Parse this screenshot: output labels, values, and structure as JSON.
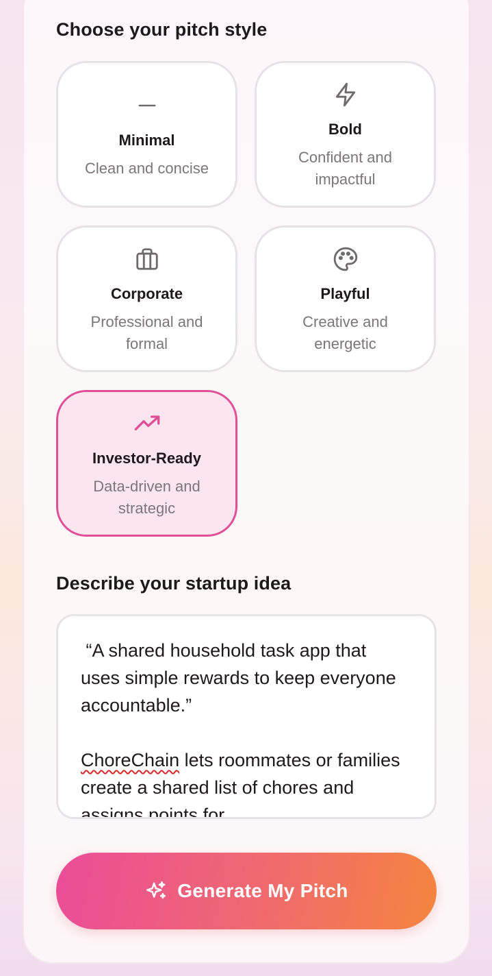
{
  "pitch_style": {
    "title": "Choose your pitch style",
    "options": [
      {
        "name": "Minimal",
        "desc": "Clean and concise",
        "icon": "minus-icon",
        "selected": false
      },
      {
        "name": "Bold",
        "desc": "Confident and impactful",
        "icon": "lightning-icon",
        "selected": false
      },
      {
        "name": "Corporate",
        "desc": "Professional and formal",
        "icon": "briefcase-icon",
        "selected": false
      },
      {
        "name": "Playful",
        "desc": "Creative and energetic",
        "icon": "palette-icon",
        "selected": false
      },
      {
        "name": "Investor-Ready",
        "desc": "Data-driven and strategic",
        "icon": "trending-up-icon",
        "selected": true
      }
    ]
  },
  "idea": {
    "title": "Describe your startup idea",
    "quote_line": " “A shared household task app that uses simple rewards to keep everyone accountable.”",
    "product_name": "ChoreChain",
    "body_rest": " lets roommates or families create a shared list of chores and assigns points for"
  },
  "generate_button": {
    "label": "Generate My Pitch",
    "icon": "sparkles-icon"
  },
  "colors": {
    "accent_pink": "#de4f97",
    "selected_bg": "#fbe6ef",
    "button_gradient_start": "#ea4c98",
    "button_gradient_end": "#f5853e"
  }
}
